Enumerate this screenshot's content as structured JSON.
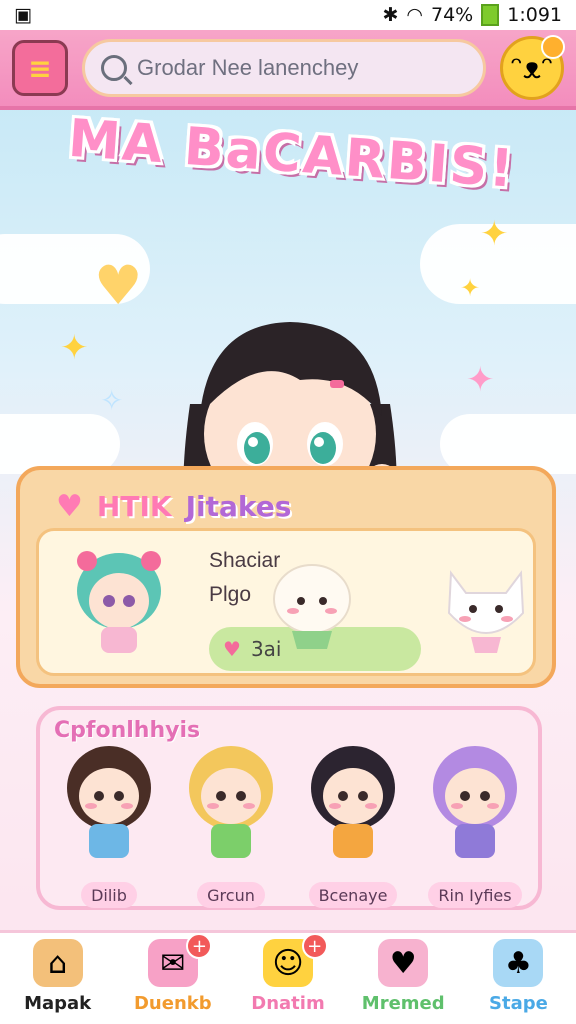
{
  "status_bar": {
    "battery": "74%",
    "time": "1:091"
  },
  "top_bar": {
    "search_placeholder": "Grodar Nee lanenchey"
  },
  "hero": {
    "title": "MA BaCARBIS!"
  },
  "featured": {
    "tab_word_1": "HTIK",
    "tab_word_2": "Jitakes",
    "label_1": "Shaciar",
    "label_2": "Plgo",
    "pill_value": "3ai"
  },
  "collection": {
    "title": "Cpfonlhhyis",
    "characters": [
      {
        "name": "Dilib",
        "hair": "#4a2e26",
        "dress": "#6db7e6"
      },
      {
        "name": "Grcun",
        "hair": "#f3c75c",
        "dress": "#7ccf6a"
      },
      {
        "name": "Bcenaye",
        "hair": "#2c2430",
        "dress": "#f4a640"
      },
      {
        "name": "Rin Iyfies",
        "hair": "#b38ae2",
        "dress": "#8f7ad8"
      }
    ]
  },
  "nav": {
    "items": [
      {
        "label": "Mapak",
        "color": "#222222",
        "icon": "home-icon"
      },
      {
        "label": "Duenkb",
        "color": "#f29b2e",
        "icon": "gift-card-icon"
      },
      {
        "label": "Dnatim",
        "color": "#f27ab0",
        "icon": "chat-mascot-icon"
      },
      {
        "label": "Mremed",
        "color": "#5fc06c",
        "icon": "pig-icon"
      },
      {
        "label": "Stape",
        "color": "#4aa9e6",
        "icon": "cat-icon"
      }
    ]
  },
  "colors": {
    "accent_pink": "#f38dbd",
    "panel_orange": "#f9d7a6",
    "panel_pink": "#fde9f2"
  }
}
